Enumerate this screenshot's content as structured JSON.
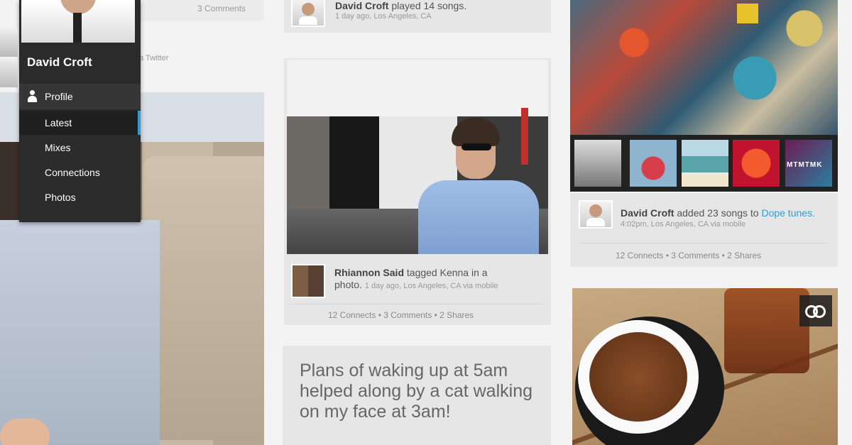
{
  "left_column": {
    "top_card_comments": "3 Comments",
    "twitter_fragment": "a Twitter"
  },
  "profile_menu": {
    "name": "David Croft",
    "profile_label": "Profile",
    "items": [
      {
        "label": "Latest",
        "active": true
      },
      {
        "label": "Mixes",
        "active": false
      },
      {
        "label": "Connections",
        "active": false
      },
      {
        "label": "Photos",
        "active": false
      }
    ],
    "accent_color": "#2a9fd8"
  },
  "middle_column": {
    "played_post": {
      "author": "David Croft",
      "action": "played 14 songs.",
      "meta": "1 day ago, Los Angeles, CA"
    },
    "tag_post": {
      "author": "Rhiannon Said",
      "action_before": "tagged Kenna in a",
      "action_after": "photo.",
      "meta": "1 day ago, Los Angeles, CA via mobile",
      "stats": "12 Connects  •  3 Comments  •  2 Shares"
    },
    "quote_post": {
      "text": "Plans of waking up at 5am helped along by a cat walking on my face at 3am!"
    }
  },
  "right_column": {
    "playlist_thumbs": [
      {
        "icon": "album-cover-1"
      },
      {
        "icon": "album-cover-2"
      },
      {
        "icon": "album-cover-3"
      },
      {
        "icon": "album-cover-4"
      },
      {
        "icon": "album-cover-5",
        "text": "MTMTMK"
      }
    ],
    "added_post": {
      "author": "David Croft",
      "action": "added 23 songs to",
      "playlist": "Dope tunes.",
      "meta": "4:02pm, Los Angeles, CA via mobile",
      "stats": "12 Connects  •  3 Comments  •  2 Shares"
    },
    "share_icon": "linked-rings-icon"
  }
}
